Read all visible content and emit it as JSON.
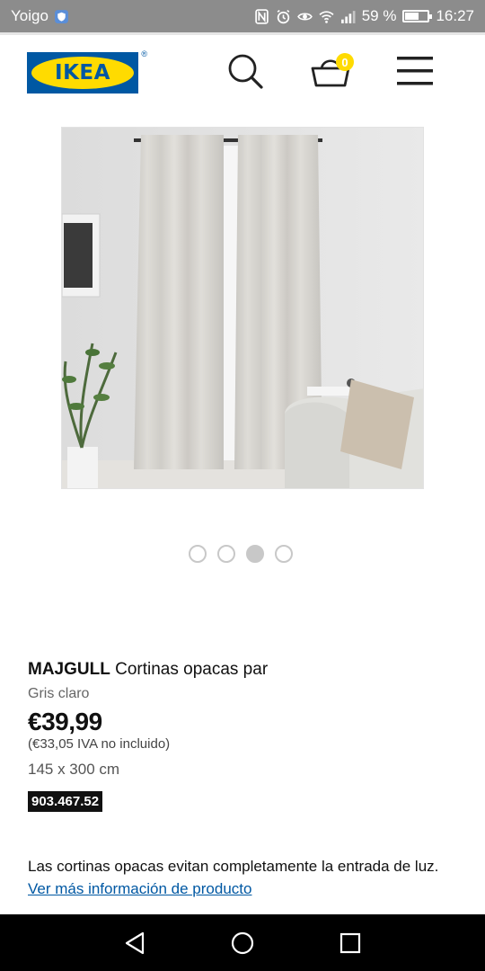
{
  "status_bar": {
    "carrier": "Yoigo",
    "battery_percent": "59 %",
    "time": "16:27",
    "battery_level": 0.59
  },
  "header": {
    "logo_text": "IKEA",
    "logo_registered": "®",
    "cart_count": "0",
    "brand_blue": "#0058a3",
    "brand_yellow": "#ffdb00"
  },
  "carousel": {
    "total_slides": 4,
    "active_slide": 3
  },
  "product": {
    "name": "MAJGULL",
    "description": "Cortinas opacas par",
    "color": "Gris claro",
    "price": "€39,99",
    "price_excl_vat": "(€33,05 IVA no incluido)",
    "size": "145 x 300 cm",
    "article_number": "903.467.52",
    "summary": "Las cortinas opacas evitan completamente la entrada de luz.",
    "more_info_link": "Ver más información de producto"
  }
}
